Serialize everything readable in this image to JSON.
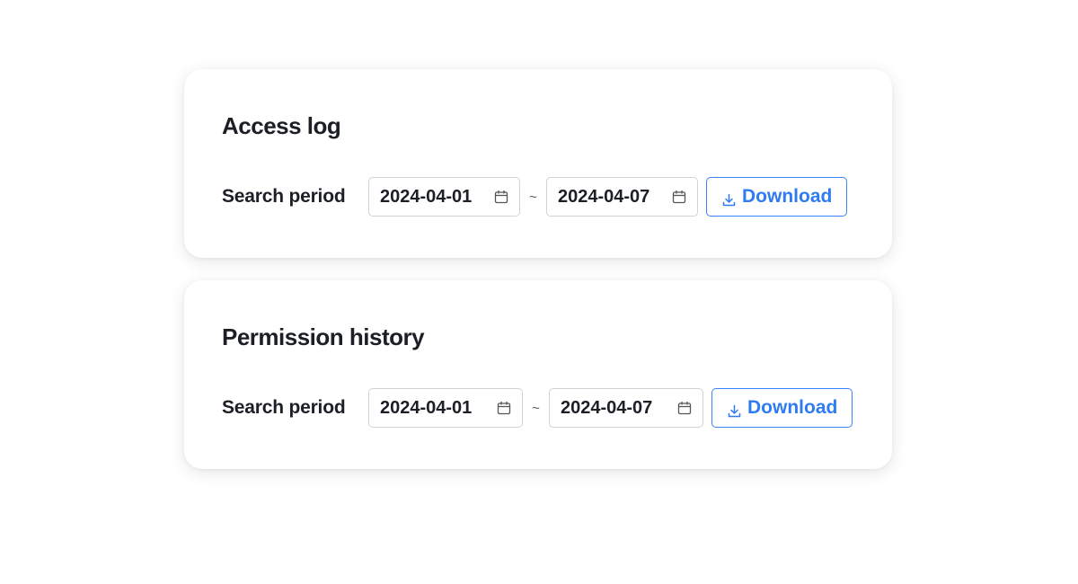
{
  "cards": [
    {
      "title": "Access log",
      "period_label": "Search period",
      "start_date": "2024-04-01",
      "end_date": "2024-04-07",
      "separator": "~",
      "download_label": "Download"
    },
    {
      "title": "Permission history",
      "period_label": "Search period",
      "start_date": "2024-04-01",
      "end_date": "2024-04-07",
      "separator": "~",
      "download_label": "Download"
    }
  ],
  "icons": {
    "date_picker": "calendar-icon",
    "download": "download-icon"
  },
  "colors": {
    "accent": "#2f7bf2",
    "text": "#1c1f26",
    "border": "#cfd3da"
  }
}
